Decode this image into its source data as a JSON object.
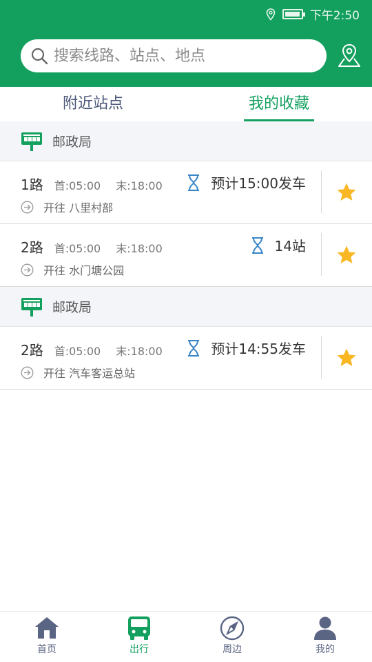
{
  "status_bar": {
    "time": "下午2:50"
  },
  "search": {
    "placeholder": "搜索线路、站点、地点"
  },
  "tabs": [
    {
      "label": "附近站点",
      "active": false
    },
    {
      "label": "我的收藏",
      "active": true
    }
  ],
  "groups": [
    {
      "stop_name": "邮政局",
      "routes": [
        {
          "route": "1路",
          "first": "首:05:00",
          "last": "末:18:00",
          "eta": "预计15:00发车",
          "direction": "开往 八里村部"
        },
        {
          "route": "2路",
          "first": "首:05:00",
          "last": "末:18:00",
          "eta": "14站",
          "direction": "开往 水门塘公园"
        }
      ]
    },
    {
      "stop_name": "邮政局",
      "routes": [
        {
          "route": "2路",
          "first": "首:05:00",
          "last": "末:18:00",
          "eta": "预计14:55发车",
          "direction": "开往 汽车客运总站"
        }
      ]
    }
  ],
  "bottom_nav": [
    {
      "label": "首页",
      "icon": "home-icon",
      "active": false
    },
    {
      "label": "出行",
      "icon": "bus-icon",
      "active": true
    },
    {
      "label": "周边",
      "icon": "compass-icon",
      "active": false
    },
    {
      "label": "我的",
      "icon": "user-icon",
      "active": false
    }
  ],
  "colors": {
    "brand": "#13a05e",
    "star": "#f9b724",
    "eta_icon": "#3a86c8",
    "nav_icon": "#5a6483"
  }
}
